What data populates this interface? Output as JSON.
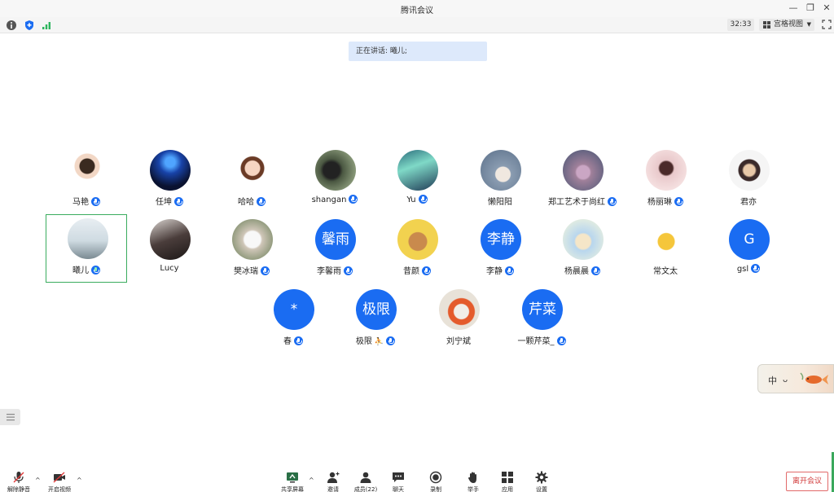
{
  "window": {
    "title": "腾讯会议"
  },
  "topbar": {
    "timer": "32:33",
    "view_label": "宫格视图"
  },
  "speaking_banner": "正在讲话: 曦儿;",
  "participants": [
    {
      "name": "马艳",
      "mic": true,
      "avatar": "photo-woman"
    },
    {
      "name": "任坤",
      "mic": true,
      "avatar": "photo-night"
    },
    {
      "name": "哈哈",
      "mic": true,
      "avatar": "cartoon-girl"
    },
    {
      "name": "shangan",
      "mic": true,
      "avatar": "photo-dark"
    },
    {
      "name": "Yu",
      "mic": true,
      "avatar": "photo-aurora"
    },
    {
      "name": "懒阳阳",
      "mic": false,
      "avatar": "photo-cartoon"
    },
    {
      "name": "郑工艺术于尚红",
      "mic": true,
      "avatar": "photo-art"
    },
    {
      "name": "杨丽琳",
      "mic": true,
      "avatar": "photo-pink"
    },
    {
      "name": "君亦",
      "mic": false,
      "avatar": "anime-boy"
    },
    {
      "name": "曦儿",
      "mic": true,
      "avatar": "photo-girl",
      "active": true
    },
    {
      "name": "Lucy",
      "mic": false,
      "avatar": "photo-hair"
    },
    {
      "name": "樊冰瑞",
      "mic": true,
      "avatar": "photo-flowers"
    },
    {
      "name": "李馨雨",
      "mic": true,
      "avatar": "text",
      "initials": "馨雨"
    },
    {
      "name": "昔颜",
      "mic": true,
      "avatar": "cartoon-jerry"
    },
    {
      "name": "李静",
      "mic": true,
      "avatar": "text",
      "initials": "李静"
    },
    {
      "name": "杨晨晨",
      "mic": true,
      "avatar": "photo-child"
    },
    {
      "name": "常文太",
      "mic": false,
      "avatar": "pikachu"
    },
    {
      "name": "gsl",
      "mic": true,
      "avatar": "text",
      "initials": "G"
    },
    {
      "name": "春",
      "mic": true,
      "avatar": "text",
      "initials": "*"
    },
    {
      "name": "极限",
      "mic": true,
      "avatar": "text",
      "initials": "极限",
      "extra": "⛹"
    },
    {
      "name": "刘宁斌",
      "mic": false,
      "avatar": "photo-painting"
    },
    {
      "name": "一颗芹菜_",
      "mic": true,
      "avatar": "text",
      "initials": "芹菜"
    }
  ],
  "float_card": {
    "char": "中"
  },
  "toolbar": {
    "unmute": "解除静音",
    "start_video": "开启视频",
    "share_screen": "共享屏幕",
    "invite": "邀请",
    "members": "成员(22)",
    "chat": "聊天",
    "record": "录制",
    "raise_hand": "举手",
    "apps": "应用",
    "settings": "设置",
    "leave": "离开会议"
  },
  "colors": {
    "accent": "#1a6cf2",
    "active_border": "#3aac5e",
    "leave": "#d23c3c"
  }
}
